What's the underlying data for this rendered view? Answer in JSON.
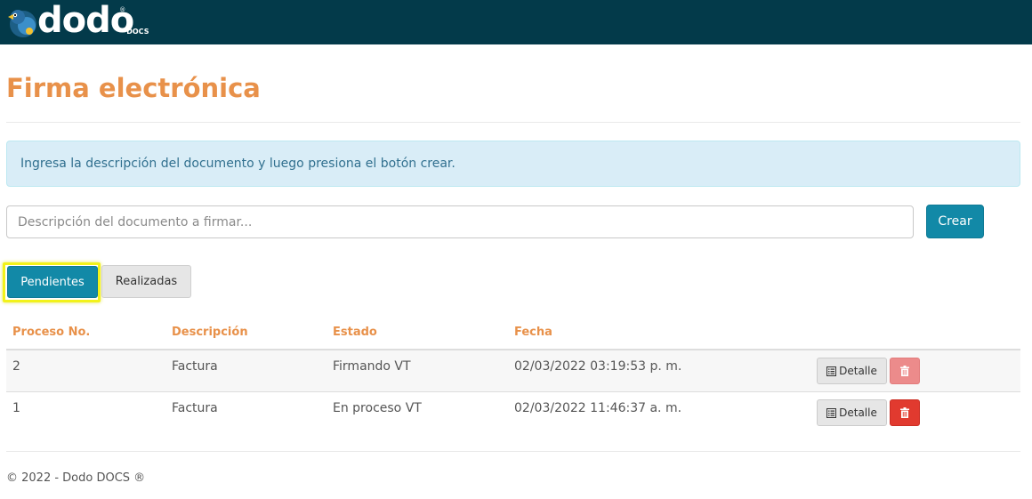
{
  "brand": {
    "name": "dodo",
    "sub": "DOCS",
    "reg": "®"
  },
  "page": {
    "title": "Firma electrónica"
  },
  "alert": {
    "text": "Ingresa la descripción del documento y luego presiona el botón crear."
  },
  "form": {
    "placeholder": "Descripción del documento a firmar...",
    "value": "",
    "create_label": "Crear"
  },
  "tabs": [
    {
      "label": "Pendientes",
      "active": true
    },
    {
      "label": "Realizadas",
      "active": false
    }
  ],
  "table": {
    "headers": [
      "Proceso No.",
      "Descripción",
      "Estado",
      "Fecha"
    ],
    "rows": [
      {
        "proceso": "2",
        "descripcion": "Factura",
        "estado": "Firmando VT",
        "fecha": "02/03/2022 03:19:53 p. m.",
        "detail_label": "Detalle"
      },
      {
        "proceso": "1",
        "descripcion": "Factura",
        "estado": "En proceso VT",
        "fecha": "02/03/2022 11:46:37 a. m.",
        "detail_label": "Detalle"
      }
    ]
  },
  "footer": {
    "text": "© 2022 - Dodo DOCS ®"
  },
  "colors": {
    "topbar": "#033a4a",
    "accent_orange": "#e8914a",
    "primary": "#1289a7",
    "alert_bg": "#d9edf7",
    "danger": "#e13a2f",
    "danger_disabled": "#ec8b8b",
    "highlight": "#f2f21a"
  },
  "icons": {
    "detail": "list-icon",
    "delete": "trash-icon",
    "logo": "dodo-bird-logo"
  }
}
